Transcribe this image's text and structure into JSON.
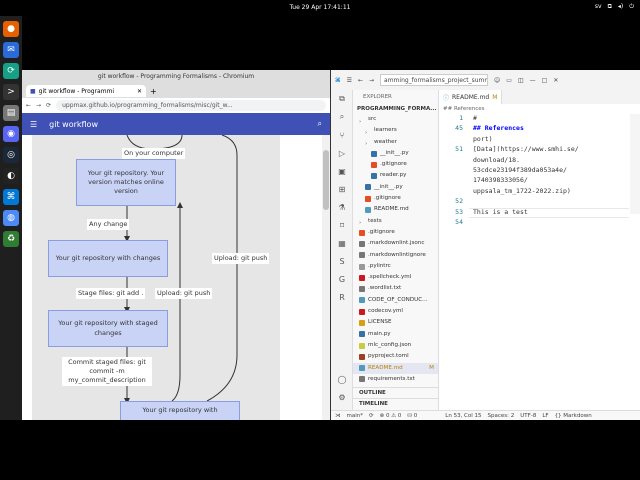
{
  "system": {
    "clock": "Tue 29 Apr  17:41:11",
    "lang": "sv"
  },
  "dock": {
    "apps": [
      {
        "name": "firefox-icon",
        "color": "#e66000",
        "glyph": "●"
      },
      {
        "name": "thunderbird-icon",
        "color": "#2a6bd8",
        "glyph": "✉"
      },
      {
        "name": "sync-icon",
        "color": "#16a085",
        "glyph": "⟳"
      },
      {
        "name": "terminal-icon",
        "color": "#333333",
        "glyph": ">"
      },
      {
        "name": "files-icon",
        "color": "#777777",
        "glyph": "▤"
      },
      {
        "name": "discord-icon",
        "color": "#5865f2",
        "glyph": "◉"
      },
      {
        "name": "steam-icon",
        "color": "#1b2838",
        "glyph": "◎"
      },
      {
        "name": "obs-icon",
        "color": "#222222",
        "glyph": "◐"
      },
      {
        "name": "vscode-icon",
        "color": "#0078d4",
        "glyph": "⌘"
      },
      {
        "name": "chromium-icon",
        "color": "#4c8bf5",
        "glyph": "◍"
      },
      {
        "name": "trash-icon",
        "color": "#2e7d32",
        "glyph": "♻"
      }
    ]
  },
  "browser": {
    "window_title": "git workflow - Programming Formalisms - Chromium",
    "tab_title": "git workflow - Programmi",
    "url": "uppmax.github.io/programming_formalisms/misc/git_w...",
    "app_title": "git workflow",
    "diagram": {
      "on_your_computer": "On your computer",
      "node_matches": "Your git repository. Your version matches online version",
      "any_change": "Any change",
      "node_changes": "Your git repository with changes",
      "stage_files": "Stage files: git add .",
      "node_staged": "Your git repository with staged changes",
      "commit_label": "Commit staged files: git commit -m my_commit_description",
      "node_with": "Your git repository with",
      "upload_push_1": "Upload: git push",
      "upload_push_2": "Upload: git push"
    }
  },
  "vscode": {
    "search_text": "amming_formalisms_project_summ",
    "explorer_header": "EXPLORER",
    "project": "PROGRAMMING_FORMA...",
    "tree": [
      {
        "label": "src",
        "indent": 1,
        "kind": "folder",
        "color": "#666"
      },
      {
        "label": "learners",
        "indent": 2,
        "kind": "folder",
        "color": "#666"
      },
      {
        "label": "weather",
        "indent": 2,
        "kind": "folder",
        "color": "#666"
      },
      {
        "label": "__init__.py",
        "indent": 3,
        "kind": "py",
        "color": "#3572A5"
      },
      {
        "label": ".gitignore",
        "indent": 3,
        "kind": "git",
        "color": "#e44d26"
      },
      {
        "label": "reader.py",
        "indent": 3,
        "kind": "py",
        "color": "#3572A5"
      },
      {
        "label": "__init__.py",
        "indent": 2,
        "kind": "py",
        "color": "#3572A5"
      },
      {
        "label": ".gitignore",
        "indent": 2,
        "kind": "git",
        "color": "#e44d26"
      },
      {
        "label": "README.md",
        "indent": 2,
        "kind": "md",
        "color": "#519aba"
      },
      {
        "label": "tests",
        "indent": 1,
        "kind": "folder",
        "color": "#666"
      },
      {
        "label": ".gitignore",
        "indent": 1,
        "kind": "git",
        "color": "#e44d26"
      },
      {
        "label": ".markdownlint.jsonc",
        "indent": 1,
        "kind": "md",
        "color": "#777"
      },
      {
        "label": ".markdownlintignore",
        "indent": 1,
        "kind": "md",
        "color": "#777"
      },
      {
        "label": ".pylintrc",
        "indent": 1,
        "kind": "cfg",
        "color": "#999"
      },
      {
        "label": ".spellcheck.yml",
        "indent": 1,
        "kind": "yml",
        "color": "#cb171e"
      },
      {
        "label": ".wordlist.txt",
        "indent": 1,
        "kind": "txt",
        "color": "#777"
      },
      {
        "label": "CODE_OF_CONDUC...",
        "indent": 1,
        "kind": "md",
        "color": "#519aba"
      },
      {
        "label": "codecov.yml",
        "indent": 1,
        "kind": "yml",
        "color": "#cb171e"
      },
      {
        "label": "LICENSE",
        "indent": 1,
        "kind": "lic",
        "color": "#d4a017"
      },
      {
        "label": "main.py",
        "indent": 1,
        "kind": "py",
        "color": "#3572A5"
      },
      {
        "label": "mlc_config.json",
        "indent": 1,
        "kind": "json",
        "color": "#cbcb41"
      },
      {
        "label": "pyproject.toml",
        "indent": 1,
        "kind": "toml",
        "color": "#9c4221"
      },
      {
        "label": "README.md",
        "indent": 1,
        "kind": "md",
        "color": "#519aba",
        "active": true,
        "badge": "M"
      },
      {
        "label": "requirements.txt",
        "indent": 1,
        "kind": "txt",
        "color": "#777"
      }
    ],
    "outline": "OUTLINE",
    "timeline": "TIMELINE",
    "editor_tab": "README.md",
    "editor_tab_badge": "M",
    "breadcrumb": "## References",
    "lines": [
      {
        "n": "1",
        "t": "#"
      },
      {
        "n": "45",
        "t": "## References",
        "hd": true
      },
      {
        "n": "",
        "t": "port)"
      },
      {
        "n": "51",
        "t": "[Data](https://www.smhi.se/"
      },
      {
        "n": "",
        "t": "download/18."
      },
      {
        "n": "",
        "t": "53cdce23194f389da053a4e/"
      },
      {
        "n": "",
        "t": "1740398333056/"
      },
      {
        "n": "",
        "t": "uppsala_tm_1722-2022.zip)"
      },
      {
        "n": "52",
        "t": ""
      },
      {
        "n": "53",
        "t": "This is a test"
      },
      {
        "n": "54",
        "t": ""
      }
    ],
    "status": {
      "branch": "main*",
      "sync": "⟳",
      "problems": "⊗ 0 ⚠ 0",
      "ports": "⛁ 0",
      "position": "Ln 53, Col 15",
      "spaces": "Spaces: 2",
      "encoding": "UTF-8",
      "eol": "LF",
      "language": "{} Markdown"
    }
  }
}
